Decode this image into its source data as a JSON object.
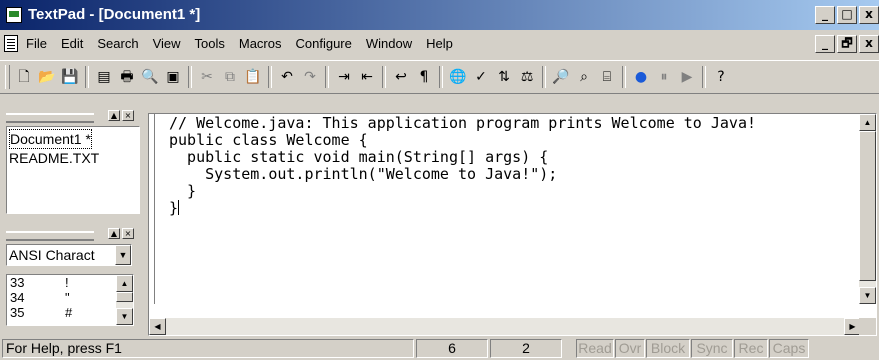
{
  "window": {
    "title": "TextPad - [Document1 *]",
    "buttons": [
      "_",
      "□",
      "x"
    ]
  },
  "menubar": {
    "items": [
      {
        "label": "File"
      },
      {
        "label": "Edit"
      },
      {
        "label": "Search"
      },
      {
        "label": "View"
      },
      {
        "label": "Tools"
      },
      {
        "label": "Macros"
      },
      {
        "label": "Configure"
      },
      {
        "label": "Window"
      },
      {
        "label": "Help"
      }
    ],
    "mdi_buttons": [
      "_",
      "🗗",
      "x"
    ]
  },
  "toolbar": {
    "icons": [
      {
        "name": "new-document-icon",
        "glyph": "🗋"
      },
      {
        "name": "open-folder-icon",
        "glyph": "📂"
      },
      {
        "name": "save-icon",
        "glyph": "💾"
      },
      {
        "name": "manage-files-icon",
        "glyph": "▤"
      },
      {
        "name": "print-icon",
        "glyph": "🖶"
      },
      {
        "name": "print-preview-icon",
        "glyph": "🔍"
      },
      {
        "name": "screen-icon",
        "glyph": "▣"
      },
      {
        "name": "cut-icon",
        "glyph": "✂"
      },
      {
        "name": "copy-icon",
        "glyph": "⧉"
      },
      {
        "name": "paste-icon",
        "glyph": "📋"
      },
      {
        "name": "undo-icon",
        "glyph": "↶"
      },
      {
        "name": "redo-icon",
        "glyph": "↷"
      },
      {
        "name": "indent-icon",
        "glyph": "⇥"
      },
      {
        "name": "outdent-icon",
        "glyph": "⇤"
      },
      {
        "name": "word-wrap-icon",
        "glyph": "↩"
      },
      {
        "name": "show-paragraph-icon",
        "glyph": "¶"
      },
      {
        "name": "web-browser-icon",
        "glyph": "🌐"
      },
      {
        "name": "spell-check-icon",
        "glyph": "✓"
      },
      {
        "name": "sort-icon",
        "glyph": "⇅"
      },
      {
        "name": "compare-icon",
        "glyph": "⚖"
      },
      {
        "name": "find-icon",
        "glyph": "🔎"
      },
      {
        "name": "find-in-files-icon",
        "glyph": "⌕"
      },
      {
        "name": "binoculars-icon",
        "glyph": "⌸"
      },
      {
        "name": "record-macro-icon",
        "glyph": "●"
      },
      {
        "name": "pause-macro-icon",
        "glyph": "⏸"
      },
      {
        "name": "play-macro-icon",
        "glyph": "▶"
      },
      {
        "name": "context-help-icon",
        "glyph": "?"
      }
    ]
  },
  "documents": {
    "items": [
      {
        "label": "Document1 *"
      },
      {
        "label": "README.TXT"
      }
    ]
  },
  "clip_library": {
    "selected": "ANSI Charact",
    "rows": [
      {
        "code": "33",
        "char": "!"
      },
      {
        "code": "34",
        "char": "\""
      },
      {
        "code": "35",
        "char": "#"
      }
    ]
  },
  "editor": {
    "lines": [
      "// Welcome.java: This application program prints Welcome to Java!",
      "public class Welcome {",
      "  public static void main(String[] args) {",
      "    System.out.println(\"Welcome to Java!\");",
      "  }",
      "}"
    ]
  },
  "statusbar": {
    "help": "For Help, press F1",
    "line": "6",
    "column": "2",
    "indicators": [
      "Read",
      "Ovr",
      "Block",
      "Sync",
      "Rec",
      "Caps"
    ]
  }
}
